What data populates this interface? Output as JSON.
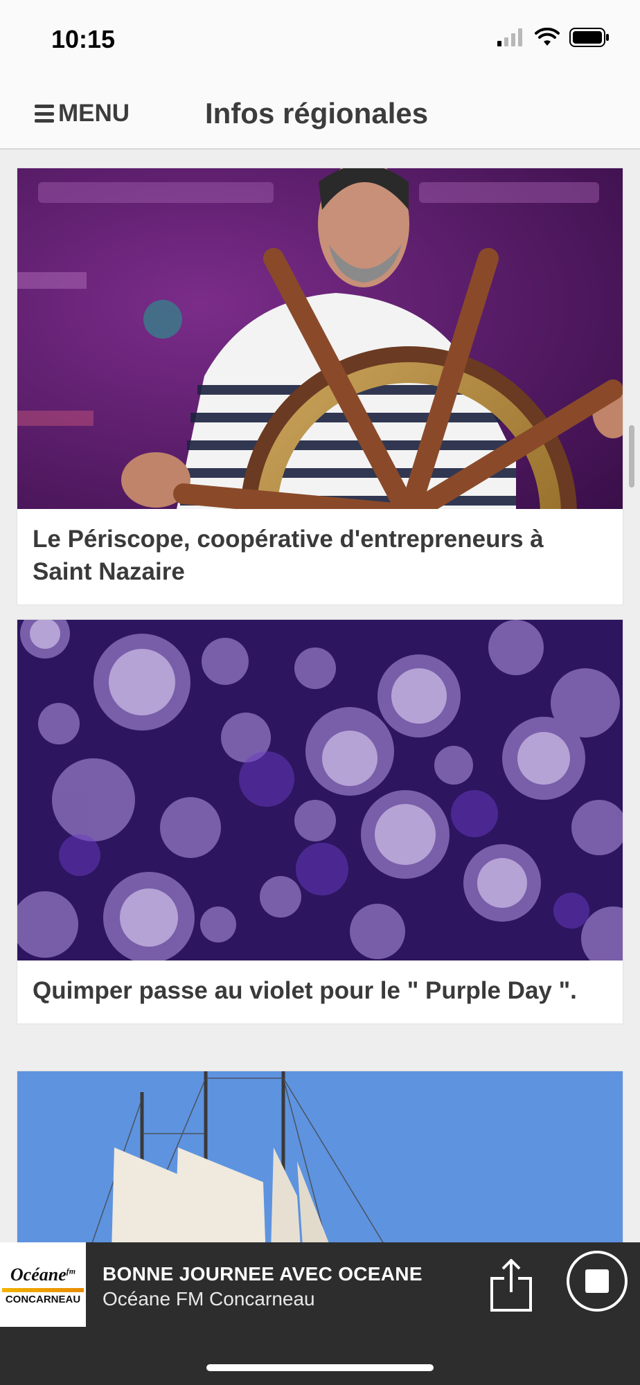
{
  "status_bar": {
    "time": "10:15",
    "icons": [
      "cellular-signal-icon",
      "wifi-icon",
      "battery-icon"
    ]
  },
  "header": {
    "menu_label": "MENU",
    "menu_icon": "hamburger-icon",
    "title": "Infos régionales"
  },
  "articles": [
    {
      "title": "Le Périscope, coopérative d'entrepreneurs à Saint Nazaire",
      "image": "man-with-ship-wheel"
    },
    {
      "title": "Quimper passe au violet pour le \" Purple Day \".",
      "image": "purple-bokeh"
    },
    {
      "title": "",
      "image": "tall-ship-sails"
    }
  ],
  "player": {
    "logo_text": "Océane",
    "logo_fm": "fm",
    "logo_sub": "CONCARNEAU",
    "now_playing": "BONNE JOURNEE AVEC OCEANE",
    "station": "Océane FM Concarneau",
    "share_icon": "share-icon",
    "stop_icon": "stop-icon"
  },
  "colors": {
    "player_bg": "#2d2d2d",
    "header_bg": "#fafafa",
    "page_bg": "#eeeeee"
  }
}
